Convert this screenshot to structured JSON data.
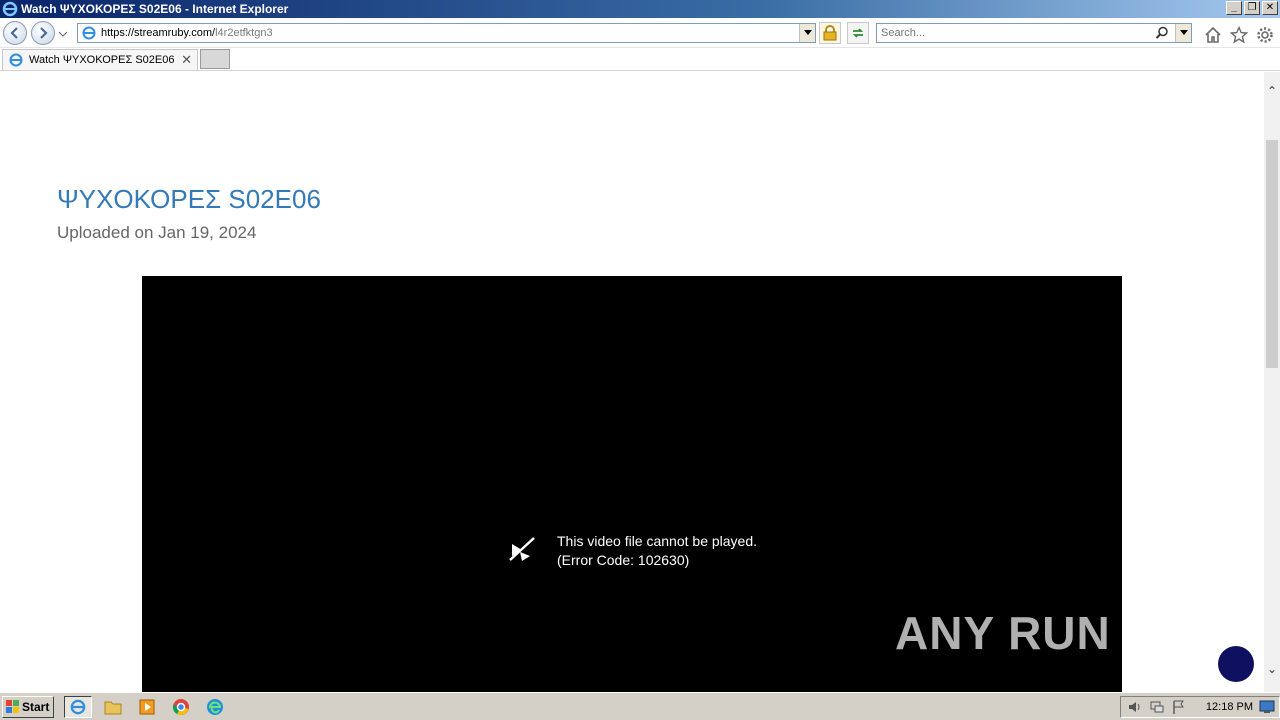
{
  "window": {
    "title": "Watch ΨΥΧΟΚΟΡΕΣ S02E06 - Internet Explorer",
    "controls": [
      "_",
      "❐",
      "✕"
    ]
  },
  "navbar": {
    "url_host": "https://streamruby.com/",
    "url_path": "l4r2etfktgn3",
    "search_placeholder": "Search..."
  },
  "tabs": [
    {
      "label": "Watch ΨΥΧΟΚΟΡΕΣ S02E06",
      "close": "✕"
    }
  ],
  "page": {
    "video_title": "ΨΥΧΟΚΟΡΕΣ S02E06",
    "upload_info": "Uploaded on Jan 19, 2024",
    "error_line1": "This video file cannot be played.",
    "error_line2": "(Error Code: 102630)",
    "watermark": "ANY  RUN"
  },
  "scrollbar": {
    "up": "⌃",
    "down": "⌄"
  },
  "taskbar": {
    "start_label": "Start",
    "clock": "12:18 PM"
  },
  "colors": {
    "title_link": "#337ab7",
    "player_bg": "#000000",
    "chat_button": "#101060"
  }
}
